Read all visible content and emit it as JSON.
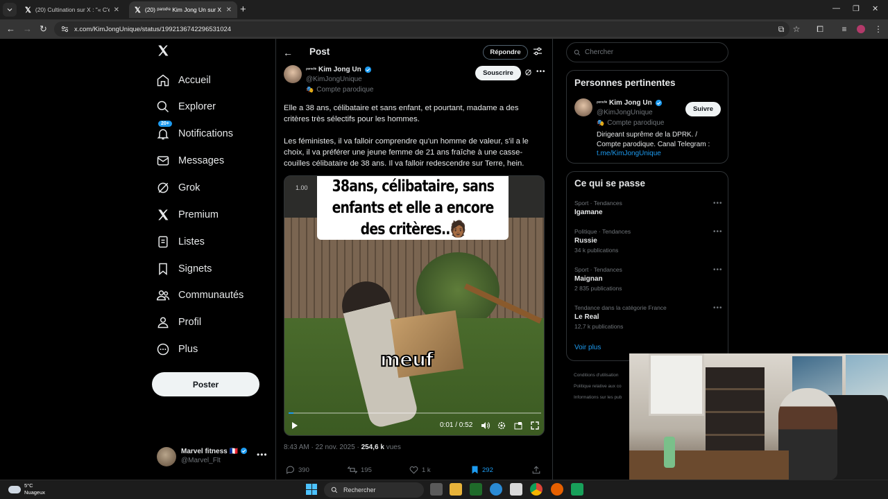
{
  "browser": {
    "tabs": [
      {
        "label": "(20) Cultination sur X : \"« C'est l",
        "active": false
      },
      {
        "label": "(20) ᵖᵃʳᵒᵈⁱᵉ Kim Jong Un sur X : \"E",
        "active": true
      }
    ],
    "url": "x.com/KimJongUnique/status/1992136742296531024"
  },
  "nav": {
    "items": [
      {
        "label": "Accueil",
        "icon": "home-icon"
      },
      {
        "label": "Explorer",
        "icon": "search-icon"
      },
      {
        "label": "Notifications",
        "icon": "bell-icon",
        "badge": "20+"
      },
      {
        "label": "Messages",
        "icon": "mail-icon"
      },
      {
        "label": "Grok",
        "icon": "grok-icon"
      },
      {
        "label": "Premium",
        "icon": "x-icon"
      },
      {
        "label": "Listes",
        "icon": "list-icon"
      },
      {
        "label": "Signets",
        "icon": "bookmark-icon"
      },
      {
        "label": "Communautés",
        "icon": "people-icon"
      },
      {
        "label": "Profil",
        "icon": "person-icon"
      },
      {
        "label": "Plus",
        "icon": "more-circle-icon"
      }
    ],
    "post_button": "Poster",
    "account": {
      "name": "Marvel fitness 🇫🇷",
      "handle": "@Marvel_Flt"
    }
  },
  "post": {
    "header_title": "Post",
    "reply_button": "Répondre",
    "author": {
      "parody_tag": "ᵖᵃʳᵒᵈⁱᵉ",
      "name": "Kim Jong Un",
      "handle": "@KimJongUnique",
      "label": "Compte parodique"
    },
    "subscribe_button": "Souscrire",
    "text_1": "Elle a 38 ans, célibataire et sans enfant, et pourtant, madame a des critères très sélectifs pour les hommes.",
    "text_2": "Les féministes, il va falloir comprendre qu'un homme de valeur, s'il a le choix, il va préférer une jeune femme de 21 ans fraîche à une casse-couilles célibataire de 38 ans. Il va falloir redescendre sur Terre, hein.",
    "video": {
      "caption_lines": [
        "38ans, célibataire, sans",
        "enfants et elle a encore",
        "des critères..🧑🏾"
      ],
      "speed": "1.00",
      "subtitle": "meuf",
      "time": "0:01 / 0:52",
      "progress": 0.02
    },
    "meta": {
      "time": "8:43 AM · 22 nov. 2025 · ",
      "views": "254,6 k",
      "views_label": " vues"
    },
    "actions": {
      "replies": "390",
      "reposts": "195",
      "likes": "1 k",
      "bookmarks": "292"
    }
  },
  "right": {
    "search_placeholder": "Chercher",
    "relevant": {
      "title": "Personnes pertinentes",
      "parody_tag": "ᵖᵃʳᵒᵈⁱᵉ",
      "name": "Kim Jong Un",
      "handle": "@KimJongUnique",
      "label": "Compte parodique",
      "follow_button": "Suivre",
      "bio": "Dirigeant suprême de la DPRK. / Compte parodique. Canal Telegram : ",
      "link": "t.me/KimJongUnique"
    },
    "trends": {
      "title": "Ce qui se passe",
      "items": [
        {
          "context": "Sport · Tendances",
          "name": "Igamane",
          "count": ""
        },
        {
          "context": "Politique · Tendances",
          "name": "Russie",
          "count": "34 k publications"
        },
        {
          "context": "Sport · Tendances",
          "name": "Maignan",
          "count": "2 835 publications"
        },
        {
          "context": "Tendance dans la catégorie France",
          "name": "Le Real",
          "count": "12,7 k publications"
        }
      ],
      "see_more": "Voir plus"
    },
    "footer_links": [
      "Conditions d'utilisation",
      "Politique relative aux co",
      "Informations sur les pub"
    ]
  },
  "taskbar": {
    "weather_temp": "5°C",
    "weather_desc": "Nuageux",
    "search_label": "Rechercher"
  },
  "colors": {
    "accent": "#1d9bf0",
    "background": "#000000",
    "border": "#2f3336",
    "muted": "#71767b"
  }
}
